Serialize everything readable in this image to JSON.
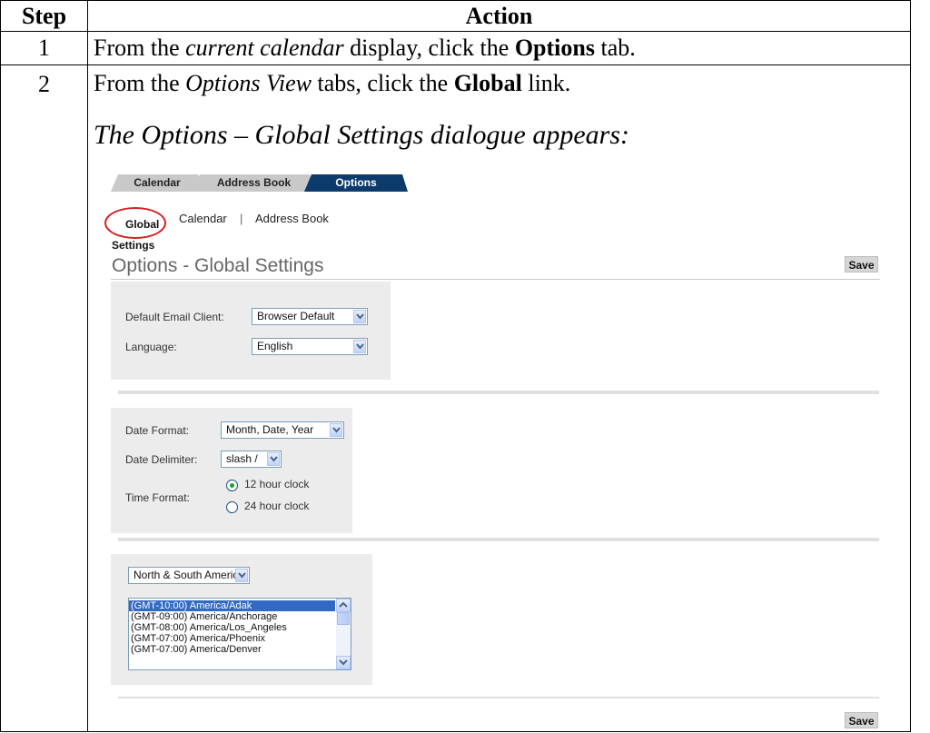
{
  "table": {
    "header_step": "Step",
    "header_action": "Action"
  },
  "steps": [
    {
      "number": "1",
      "text_pre": "From the ",
      "text_italic": "current calendar",
      "text_mid": " display, click the ",
      "text_bold": "Options",
      "text_post": " tab."
    },
    {
      "number": "2",
      "text_pre": "From the ",
      "text_italic": "Options View",
      "text_mid": " tabs, click the ",
      "text_bold": "Global",
      "text_post": " link.",
      "result": "The Options – Global Settings dialogue appears:"
    }
  ],
  "screenshot": {
    "tabs": [
      {
        "label": "Calendar",
        "active": false
      },
      {
        "label": "Address Book",
        "active": false
      },
      {
        "label": "Options",
        "active": true
      }
    ],
    "sub_links": {
      "global": "Global",
      "calendar": "Calendar",
      "separator": "|",
      "address_book": "Address Book"
    },
    "settings_label": "Settings",
    "title": "Options - Global Settings",
    "save_label": "Save",
    "fields": {
      "default_email_client_label": "Default Email Client:",
      "default_email_client_value": "Browser Default",
      "language_label": "Language:",
      "language_value": "English",
      "date_format_label": "Date Format:",
      "date_format_value": "Month, Date, Year",
      "date_delimiter_label": "Date Delimiter:",
      "date_delimiter_value": "slash /",
      "time_format_label": "Time Format:",
      "time_options": [
        {
          "label": "12 hour clock",
          "selected": true
        },
        {
          "label": "24 hour clock",
          "selected": false
        }
      ]
    },
    "timezone": {
      "region_value": "North & South America",
      "options": [
        "(GMT-10:00) America/Adak",
        "(GMT-09:00) America/Anchorage",
        "(GMT-08:00) America/Los_Angeles",
        "(GMT-07:00) America/Phoenix",
        "(GMT-07:00) America/Denver"
      ],
      "selected_index": 0
    },
    "colors": {
      "active_tab": "#0c3a6d",
      "inactive_tab": "#c9c9c9",
      "highlight_circle": "#d42020",
      "list_selection": "#316ac5"
    }
  }
}
